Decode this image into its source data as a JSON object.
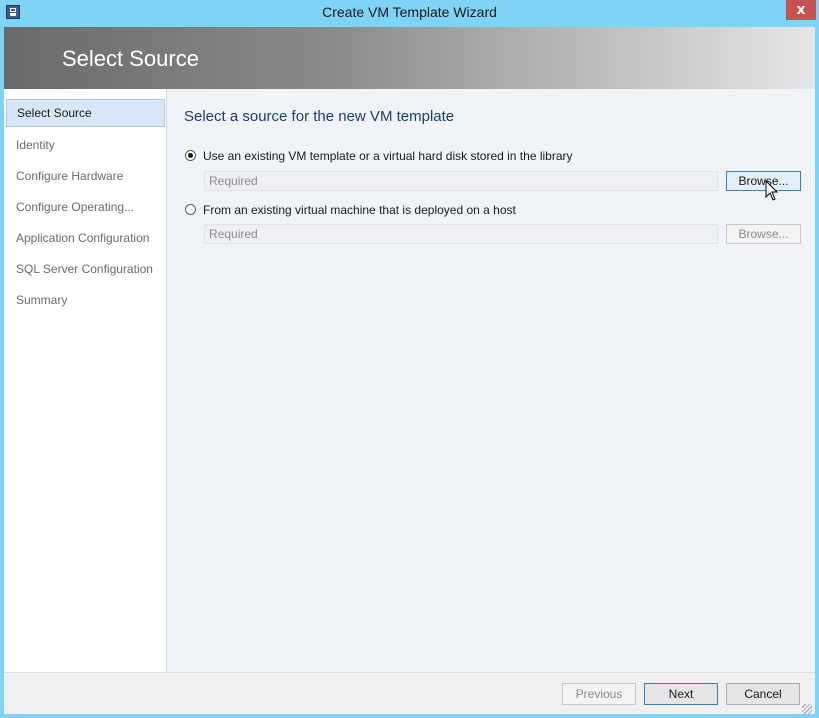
{
  "window": {
    "title": "Create VM Template Wizard",
    "close_label": "x"
  },
  "banner": {
    "title": "Select Source"
  },
  "sidebar": {
    "items": [
      {
        "label": "Select Source",
        "active": true
      },
      {
        "label": "Identity"
      },
      {
        "label": "Configure Hardware"
      },
      {
        "label": "Configure Operating..."
      },
      {
        "label": "Application Configuration"
      },
      {
        "label": "SQL Server Configuration"
      },
      {
        "label": "Summary"
      }
    ]
  },
  "main": {
    "heading": "Select a source for the new VM template",
    "option1": {
      "label": "Use an existing VM template or a virtual hard disk stored in the library",
      "selected": true,
      "placeholder": "Required",
      "browse_label": "Browse..."
    },
    "option2": {
      "label": "From an existing virtual machine that is deployed on a host",
      "selected": false,
      "placeholder": "Required",
      "browse_label": "Browse..."
    }
  },
  "footer": {
    "previous_label": "Previous",
    "next_label": "Next",
    "cancel_label": "Cancel"
  },
  "colors": {
    "window_frame": "#7fd3f5",
    "close_button": "#c75050",
    "heading_text": "#1c3f70",
    "active_nav_bg": "#d6e8f7",
    "focus_border": "#3c7fb1"
  },
  "icons": {
    "app": "vm-template-app-icon",
    "close": "close-icon",
    "cursor": "mouse-pointer-icon",
    "grip": "resize-grip-icon"
  }
}
